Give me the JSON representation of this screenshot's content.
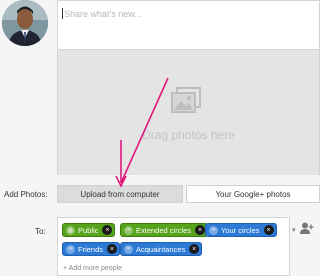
{
  "composer": {
    "placeholder": "Share what's new..."
  },
  "drop_area": {
    "text": "Drag photos here",
    "icon": "photo-icon"
  },
  "add_photos": {
    "label": "Add Photos:",
    "upload_button": "Upload from computer",
    "google_button": "Your Google+ photos"
  },
  "audience": {
    "label": "To:",
    "chips": [
      {
        "label": "Public",
        "color": "green",
        "icon": "globe-icon"
      },
      {
        "label": "Extended circles",
        "color": "green",
        "icon": "circles-icon"
      },
      {
        "label": "Your circles",
        "color": "blue",
        "icon": "circles-icon"
      },
      {
        "label": "Friends",
        "color": "blue",
        "icon": "circles-icon"
      },
      {
        "label": "Acquaintances",
        "color": "blue",
        "icon": "circles-icon"
      }
    ],
    "add_more": "+ Add more people"
  },
  "colors": {
    "annotation_arrow": "#e0177a",
    "chip_green": "#57a31b",
    "chip_blue": "#2d7ad6"
  }
}
